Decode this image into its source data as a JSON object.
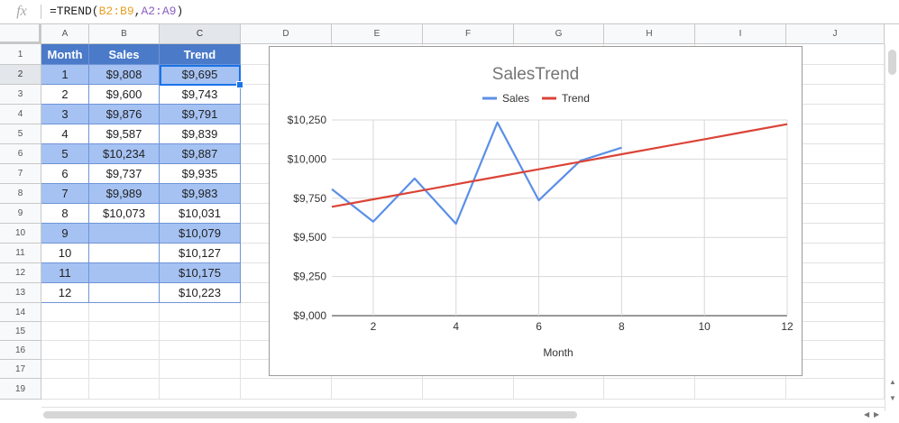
{
  "formula_bar": {
    "fx_label": "fx",
    "formula_prefix": "=TREND(",
    "formula_ref1": "B2:B9",
    "formula_comma": ",",
    "formula_ref2": "A2:A9",
    "formula_suffix": ")"
  },
  "columns": [
    "A",
    "B",
    "C",
    "D",
    "E",
    "F",
    "G",
    "H",
    "I",
    "J"
  ],
  "rows": [
    "1",
    "2",
    "3",
    "4",
    "5",
    "6",
    "7",
    "8",
    "9",
    "10",
    "11",
    "12",
    "13",
    "14",
    "15",
    "16",
    "17",
    "19"
  ],
  "table": {
    "headers": [
      "Month",
      "Sales",
      "Trend"
    ],
    "rows": [
      [
        "1",
        "$9,808",
        "$9,695"
      ],
      [
        "2",
        "$9,600",
        "$9,743"
      ],
      [
        "3",
        "$9,876",
        "$9,791"
      ],
      [
        "4",
        "$9,587",
        "$9,839"
      ],
      [
        "5",
        "$10,234",
        "$9,887"
      ],
      [
        "6",
        "$9,737",
        "$9,935"
      ],
      [
        "7",
        "$9,989",
        "$9,983"
      ],
      [
        "8",
        "$10,073",
        "$10,031"
      ],
      [
        "9",
        "",
        "$10,079"
      ],
      [
        "10",
        "",
        "$10,127"
      ],
      [
        "11",
        "",
        "$10,175"
      ],
      [
        "12",
        "",
        "$10,223"
      ]
    ]
  },
  "colors": {
    "header_fill": "#4a7ac8",
    "band_fill": "#a5c2f3",
    "sales_line": "#5b8fe8",
    "trend_line": "#db4437"
  },
  "chart_data": {
    "type": "line",
    "title": "SalesTrend",
    "xlabel": "Month",
    "ylabel": "",
    "legend_position": "top",
    "xlim": [
      1,
      12
    ],
    "ylim": [
      9000,
      10250
    ],
    "x_ticks": [
      2,
      4,
      6,
      8,
      10,
      12
    ],
    "y_ticks": [
      9000,
      9250,
      9500,
      9750,
      10000,
      10250
    ],
    "y_tick_labels": [
      "$9,000",
      "$9,250",
      "$9,500",
      "$9,750",
      "$10,000",
      "$10,250"
    ],
    "grid": true,
    "series": [
      {
        "name": "Sales",
        "x": [
          1,
          2,
          3,
          4,
          5,
          6,
          7,
          8
        ],
        "values": [
          9808,
          9600,
          9876,
          9587,
          10234,
          9737,
          9989,
          10073
        ]
      },
      {
        "name": "Trend",
        "x": [
          1,
          2,
          3,
          4,
          5,
          6,
          7,
          8,
          9,
          10,
          11,
          12
        ],
        "values": [
          9695,
          9743,
          9791,
          9839,
          9887,
          9935,
          9983,
          10031,
          10079,
          10127,
          10175,
          10223
        ]
      }
    ]
  }
}
